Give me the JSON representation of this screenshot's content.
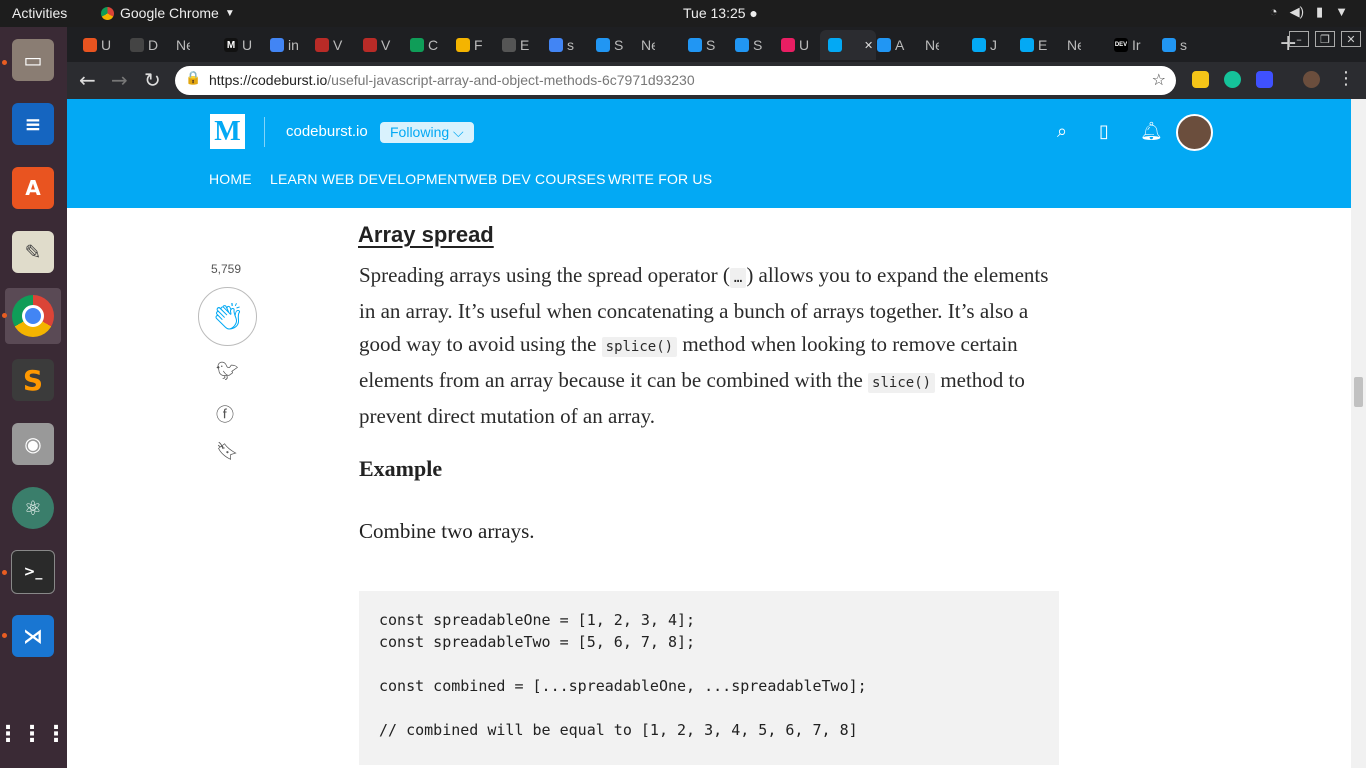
{
  "system": {
    "activities": "Activities",
    "app_name": "Google Chrome",
    "clock": "Tue 13:25"
  },
  "dock": {
    "items": [
      "files-icon",
      "writer-icon",
      "software-icon",
      "text-editor-icon",
      "chrome-icon",
      "sublime-icon",
      "camera-icon",
      "atom-icon",
      "terminal-icon",
      "vscode-icon",
      "apps-grid-icon"
    ]
  },
  "tabs": [
    {
      "label": "U",
      "color": "#e95420"
    },
    {
      "label": "D",
      "color": "#444"
    },
    {
      "label": "New",
      "color": ""
    },
    {
      "label": "U",
      "color": "#111",
      "fav": "M"
    },
    {
      "label": "in",
      "color": "#4285f4"
    },
    {
      "label": "V",
      "color": "#b92b27"
    },
    {
      "label": "V",
      "color": "#b92b27"
    },
    {
      "label": "C",
      "color": "#0f9d58"
    },
    {
      "label": "F",
      "color": "#f4b400"
    },
    {
      "label": "E",
      "color": "#555"
    },
    {
      "label": "s",
      "color": "#4285f4"
    },
    {
      "label": "S",
      "color": "#2196f3"
    },
    {
      "label": "New",
      "color": ""
    },
    {
      "label": "S",
      "color": "#2196f3"
    },
    {
      "label": "S",
      "color": "#2196f3"
    },
    {
      "label": "U",
      "color": "#e91e63"
    },
    {
      "label": "",
      "color": "#03a9f4",
      "active": true
    },
    {
      "label": "A",
      "color": "#2196f3"
    },
    {
      "label": "New",
      "color": ""
    },
    {
      "label": "J",
      "color": "#03a9f4"
    },
    {
      "label": "E",
      "color": "#03a9f4"
    },
    {
      "label": "New",
      "color": ""
    },
    {
      "label": "Ir",
      "color": "#000",
      "fav": "DEV"
    },
    {
      "label": "s",
      "color": "#2196f3"
    }
  ],
  "address_bar": {
    "url_host": "https://codeburst.io",
    "url_path": "/useful-javascript-array-and-object-methods-6c7971d93230"
  },
  "site": {
    "logo": "M",
    "publication": "codeburst.io",
    "follow_label": "Following ⌵",
    "nav": [
      "HOME",
      "LEARN WEB DEVELOPMENT",
      "WEB DEV COURSES",
      "WRITE FOR US"
    ],
    "brand_color": "#03a9f4"
  },
  "sidebar": {
    "clap_count": "5,759"
  },
  "article": {
    "heading": "Array spread",
    "para_1": "Spreading arrays using the spread operator (",
    "code_1": "…",
    "para_2": ") allows you to expand the elements in an array. It’s useful when concatenating a bunch of arrays together. It’s also a good way to avoid using the ",
    "code_2": "splice()",
    "para_3": " method when looking to remove certain elements from an array because it can be combined with the ",
    "code_3": "slice()",
    "para_4": " method to prevent direct mutation of an array.",
    "example_heading": "Example",
    "combine_text": "Combine two arrays.",
    "code_lines": "const spreadableOne = [1, 2, 3, 4];\nconst spreadableTwo = [5, 6, 7, 8];\n\nconst combined = [...spreadableOne, ...spreadableTwo];\n\n// combined will be equal to [1, 2, 3, 4, 5, 6, 7, 8]"
  }
}
